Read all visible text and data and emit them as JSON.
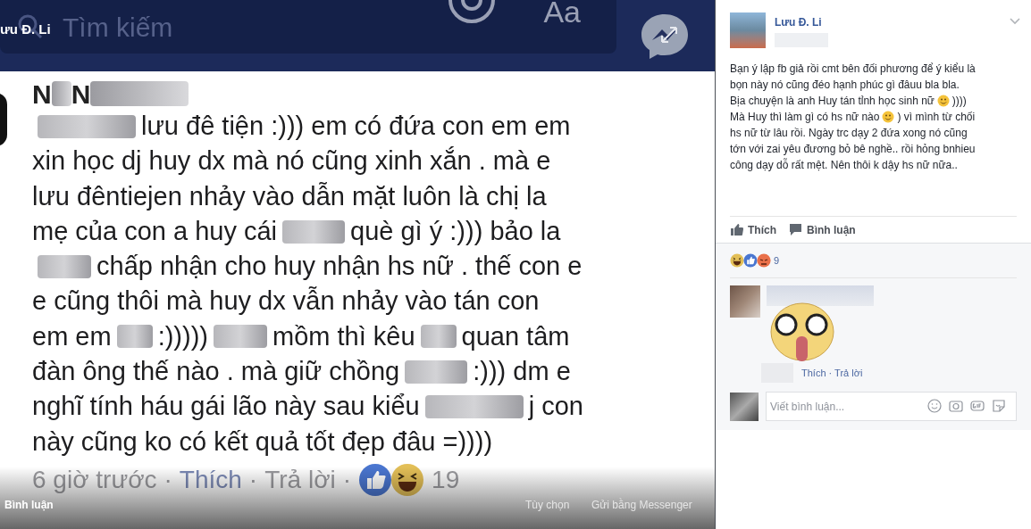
{
  "photo": {
    "header": {
      "search_placeholder": "Tìm kiếm",
      "font_button": "Aa"
    },
    "comment": {
      "name": [
        {
          "kind": "text",
          "text": "N"
        },
        {
          "kind": "blur"
        },
        {
          "kind": "text",
          "text": "N"
        },
        {
          "kind": "blur"
        }
      ],
      "lines": [
        [
          {
            "kind": "blur"
          },
          {
            "kind": "text",
            "text": "lưu đê tiện :))) em có đứa con em em"
          }
        ],
        [
          {
            "kind": "text",
            "text": "xin học dj huy dx mà nó cũng xinh xắn . mà e"
          }
        ],
        [
          {
            "kind": "text",
            "text": "lưu đêntiejen nhảy vào dẫn mặt luôn là chị la"
          }
        ],
        [
          {
            "kind": "text",
            "text": "mẹ của con a huy cái"
          },
          {
            "kind": "blur"
          },
          {
            "kind": "text",
            "text": "què gì ý :))) bảo la"
          }
        ],
        [
          {
            "kind": "blur"
          },
          {
            "kind": "text",
            "text": "chấp nhận cho huy nhận hs nữ . thế con e"
          }
        ],
        [
          {
            "kind": "text",
            "text": "e cũng thôi mà huy dx vẫn nhảy vào tán con"
          }
        ],
        [
          {
            "kind": "text",
            "text": "em em"
          },
          {
            "kind": "blur"
          },
          {
            "kind": "text",
            "text": ":)))))"
          },
          {
            "kind": "blur"
          },
          {
            "kind": "text",
            "text": "mồm thì kêu"
          },
          {
            "kind": "blur"
          },
          {
            "kind": "text",
            "text": "quan tâm"
          }
        ],
        [
          {
            "kind": "text",
            "text": "đàn ông thế nào . mà giữ chồng"
          },
          {
            "kind": "blur"
          },
          {
            "kind": "text",
            "text": ":))) dm e"
          }
        ],
        [
          {
            "kind": "text",
            "text": "nghĩ tính háu gái lão này sau kiểu"
          },
          {
            "kind": "blur"
          },
          {
            "kind": "text",
            "text": "j con"
          }
        ],
        [
          {
            "kind": "text",
            "text": "này cũng ko có kết quả tốt đẹp đâu =))))"
          }
        ]
      ],
      "time": "6 giờ trước",
      "separator": "·",
      "like": "Thích",
      "reply": "Trả lời",
      "reaction_count": "19"
    },
    "overlay": {
      "owner": "ưu Đ. Li",
      "comment_link": "Bình luận",
      "options": "Tùy chọn",
      "send": "Gửi bằng Messenger"
    }
  },
  "post": {
    "author": "Lưu Đ. Li",
    "body": [
      [
        {
          "kind": "text",
          "text": "Bạn ý lập fb giả rồi cmt bên đối phương để ý kiểu là"
        }
      ],
      [
        {
          "kind": "text",
          "text": "bọn này nó cũng đéo hạnh phúc gì đâuu bla bla."
        }
      ],
      [
        {
          "kind": "text",
          "text": "Bịa chuyện là anh Huy tán tỉnh học sinh nữ"
        },
        {
          "kind": "emoji"
        },
        {
          "kind": "text",
          "text": "))))"
        }
      ],
      [
        {
          "kind": "text",
          "text": "Mà Huy thì làm gì có hs nữ nào"
        },
        {
          "kind": "emoji"
        },
        {
          "kind": "text",
          "text": ") vì mình từ chối"
        }
      ],
      [
        {
          "kind": "text",
          "text": "hs nữ từ lâu rồi. Ngày trc dạy 2 đứa xong nó cũng"
        }
      ],
      [
        {
          "kind": "text",
          "text": "tớn với zai yêu đương bỏ bê nghề.. rồi hỏng bnhieu"
        }
      ],
      [
        {
          "kind": "text",
          "text": "công dạy dỗ rất mệt. Nên thôi k dậy hs nữ nữa.."
        }
      ]
    ],
    "actions": [
      "Thích",
      "Bình luận"
    ],
    "reaction_count": "9",
    "comment": {
      "actions": "Thích · Trả lời"
    },
    "composer": {
      "placeholder": "Viết bình luận..."
    }
  }
}
